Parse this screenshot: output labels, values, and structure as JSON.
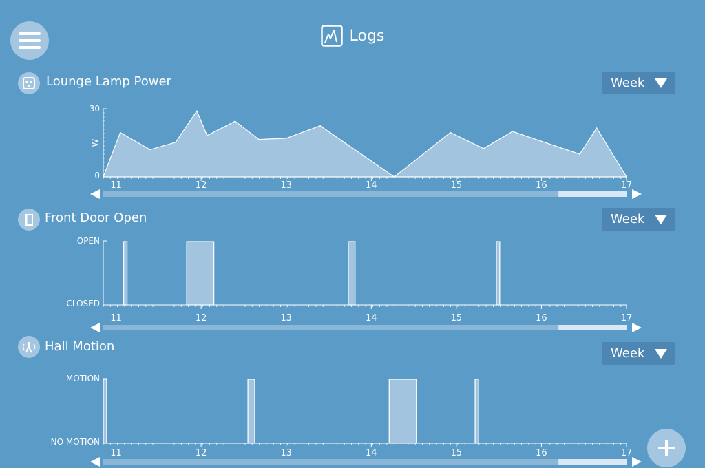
{
  "header": {
    "title": "Logs",
    "icon": "chart-icon"
  },
  "menu": {
    "icon": "hamburger-icon"
  },
  "add": {
    "icon": "plus-icon"
  },
  "charts": [
    {
      "title": "Lounge Lamp Power",
      "icon": "power-socket-icon",
      "range": "Week",
      "chart_data": {
        "type": "area",
        "x_ticks": [
          "11",
          "12",
          "13",
          "14",
          "15",
          "16",
          "17"
        ],
        "ylabel": "W",
        "y_tick_labels": [
          "30",
          "0"
        ],
        "ylim": [
          0,
          30
        ],
        "xlim": [
          10.85,
          17
        ],
        "x": [
          10.85,
          11.05,
          11.4,
          11.7,
          11.95,
          12.07,
          12.4,
          12.68,
          13.0,
          13.4,
          14.27,
          14.93,
          15.32,
          15.66,
          16.45,
          16.65,
          17.0
        ],
        "y": [
          0,
          19.5,
          12,
          15.2,
          29,
          18.2,
          24.5,
          16.5,
          17,
          22.5,
          0,
          19.5,
          12.5,
          20,
          10,
          21.5,
          0
        ]
      },
      "scroll": {
        "window_start": 0.87,
        "window_end": 1.0
      }
    },
    {
      "title": "Front Door Open",
      "icon": "door-icon",
      "range": "Week",
      "chart_data": {
        "type": "bar",
        "x_ticks": [
          "11",
          "12",
          "13",
          "14",
          "15",
          "16",
          "17"
        ],
        "y_tick_labels": [
          "OPEN",
          "CLOSED"
        ],
        "xlim": [
          10.85,
          17
        ],
        "open_intervals": [
          [
            11.09,
            11.13
          ],
          [
            11.83,
            12.15
          ],
          [
            13.73,
            13.81
          ],
          [
            15.47,
            15.51
          ]
        ]
      },
      "scroll": {
        "window_start": 0.87,
        "window_end": 1.0
      }
    },
    {
      "title": "Hall Motion",
      "icon": "motion-sensor-icon",
      "range": "Week",
      "chart_data": {
        "type": "bar",
        "x_ticks": [
          "11",
          "12",
          "13",
          "14",
          "15",
          "16",
          "17"
        ],
        "y_tick_labels": [
          "MOTION",
          "NO MOTION"
        ],
        "xlim": [
          10.85,
          17
        ],
        "open_intervals": [
          [
            10.85,
            10.89
          ],
          [
            12.55,
            12.63
          ],
          [
            14.21,
            14.53
          ],
          [
            15.22,
            15.26
          ]
        ]
      },
      "scroll": {
        "window_start": 0.87,
        "window_end": 1.0
      }
    }
  ]
}
